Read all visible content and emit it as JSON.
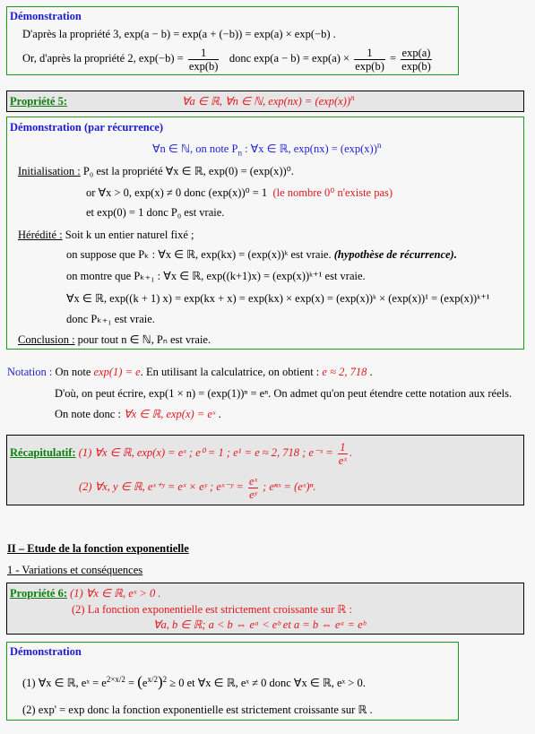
{
  "demo1": {
    "title": "Démonstration",
    "line1": "D'après la propriété 3,  exp(a − b) = exp(a + (−b)) = exp(a) × exp(−b) .",
    "line2_prefix": "Or, d'après la propriété 2,  exp(−b) =",
    "line2_frac1_num": "1",
    "line2_frac1_den": "exp(b)",
    "line2_middle": "donc  exp(a − b) = exp(a) ×",
    "line2_frac2_num": "1",
    "line2_frac2_den": "exp(b)",
    "line2_eq": "=",
    "line2_frac3_num": "exp(a)",
    "line2_frac3_den": "exp(b)"
  },
  "prop5": {
    "label": "Propriété 5:",
    "statement": "∀a ∈ ℝ, ∀n ∈ ℕ, exp(nx) = (exp(x))",
    "statement_exp": "n"
  },
  "demo2": {
    "title": "Démonstration (par récurrence)",
    "intro": "∀n ∈ ℕ,  on note  P",
    "intro_sub": "n",
    "intro_rest": " : ∀x ∈ ℝ, exp(nx) = (exp(x))",
    "intro_exp": "n",
    "init_label": "Initialisation :",
    "init_line1": " P₀  est la propriété  ∀x ∈ ℝ, exp(0) = (exp(x))⁰.",
    "init_line2": "or  ∀x > 0, exp(x) ≠ 0  donc  (exp(x))⁰ = 1",
    "init_line2_red": "(le nombre 0⁰  n'existe pas)",
    "init_line3": "et   exp(0) = 1  donc  P₀  est vraie.",
    "hered_label": "Hérédité :",
    "hered_line1": " Soit  k  un entier naturel fixé ;",
    "hered_line2": "on suppose que  Pₖ : ∀x ∈ ℝ, exp(kx) = (exp(x))ᵏ   est vraie.",
    "hered_line2_bold": "(hypothèse de récurrence).",
    "hered_line3": "on montre que  Pₖ₊₁ : ∀x ∈ ℝ, exp((k+1)x) = (exp(x))ᵏ⁺¹   est vraie.",
    "hered_line4": "∀x ∈ ℝ, exp((k + 1) x) = exp(kx + x) = exp(kx) × exp(x) = (exp(x))ᵏ × (exp(x))¹ = (exp(x))ᵏ⁺¹",
    "hered_line5": "donc  Pₖ₊₁  est vraie.",
    "concl_label": "Conclusion :",
    "concl_text": " pour tout  n ∈ ℕ, Pₙ est vraie."
  },
  "notation": {
    "label": "Notation :",
    "line1_a": " On note ",
    "line1_red1": "exp(1) = e",
    "line1_b": ". En utilisant la calculatrice, on obtient :  ",
    "line1_red2": "e ≈ 2, 718",
    "line1_c": " .",
    "line2": "D'où, on peut écrire,  exp(1 × n) = (exp(1))ⁿ = eⁿ. On admet qu'on peut étendre cette notation aux réels.",
    "line3_a": "On note donc :  ",
    "line3_red": "∀x ∈ ℝ, exp(x) = eˣ",
    "line3_b": " ."
  },
  "recap": {
    "label": "Récapitulatif:",
    "line1_a": " (1)  ∀x ∈ ℝ,    exp(x) = eˣ     ;     e⁰ = 1     ;     e¹ = e ≈ 2, 718     ;     e⁻ˣ =",
    "line1_frac_num": "1",
    "line1_frac_den": "eˣ",
    "line1_end": ".",
    "line2_a": "(2)  ∀x, y ∈ ℝ,    eˣ⁺ʸ = eˣ × eʸ     ;     eˣ⁻ʸ =",
    "line2_frac_num": "eˣ",
    "line2_frac_den": "eʸ",
    "line2_b": "     ;     eⁿˣ = (eˣ)ⁿ."
  },
  "section": {
    "title": "II – Etude de la fonction exponentielle",
    "subtitle": "1 - Variations et conséquences"
  },
  "prop6": {
    "label": "Propriété 6:",
    "line1": " (1)  ∀x ∈ ℝ, eˣ > 0 .",
    "line2": "(2) La fonction exponentielle est strictement croissante sur ℝ :",
    "line3": "∀a, b ∈ ℝ;       a < b ⇔ eᵃ < eᵇ   et   a = b ⇔ eᵃ = eᵇ"
  },
  "demo3": {
    "title": "Démonstration",
    "line1_a": "(1)  ∀x ∈ ℝ, eˣ = e",
    "line1_exp": "2×x/2",
    "line1_b": " = ",
    "line1_paren_inner": "e",
    "line1_paren_inner_exp": "x/2",
    "line1_paren_exp": "2",
    "line1_c": " ≥ 0   et   ∀x ∈ ℝ, eˣ  ≠ 0   donc   ∀x ∈ ℝ, eˣ > 0.",
    "line2": "(2) exp' = exp    donc la fonction exponentielle est strictement croissante sur ℝ ."
  }
}
